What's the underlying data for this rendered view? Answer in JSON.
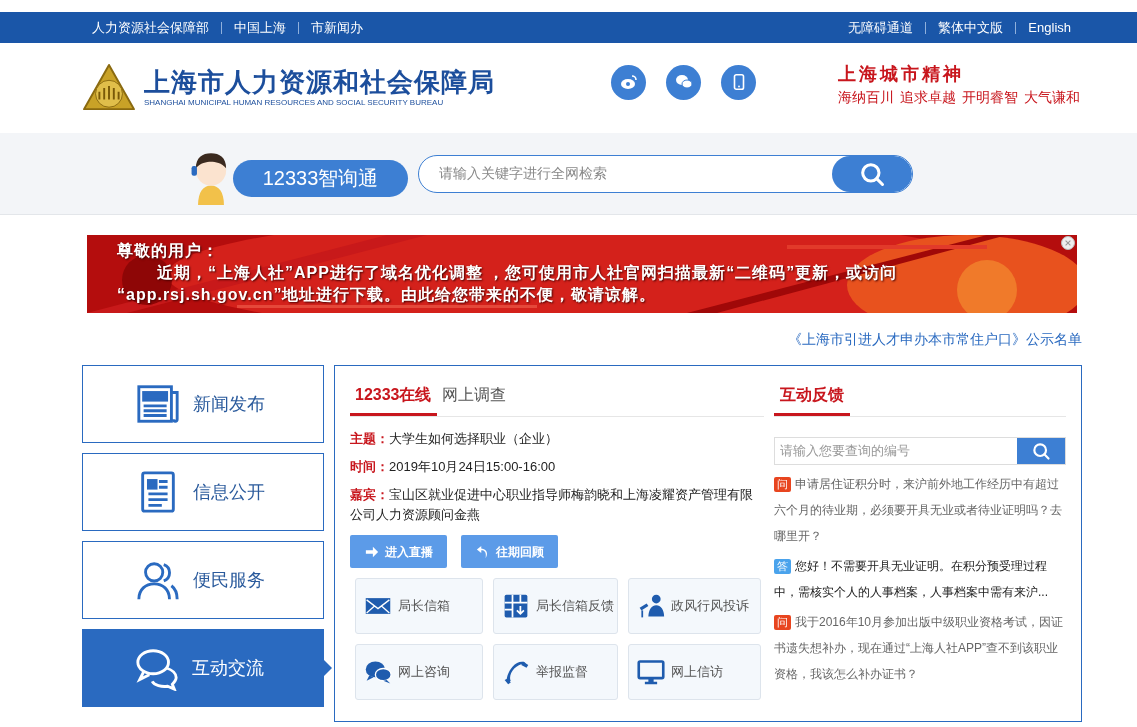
{
  "top_bar": {
    "left_links": [
      "人力资源社会保障部",
      "中国上海",
      "市新闻办"
    ],
    "right_links": [
      "无障碍通道",
      "繁体中文版",
      "English"
    ]
  },
  "header": {
    "title": "上海市人力资源和社会保障局",
    "subtitle": "SHANGHAI MUNICIPAL HUMAN RESOURCES AND SOCIAL SECURITY BUREAU",
    "spirit_title": "上海城市精神",
    "spirit_slogans": [
      "海纳百川",
      "追求卓越",
      "开明睿智",
      "大气谦和"
    ]
  },
  "search_band": {
    "assistant_label": "12333智询通",
    "search": {
      "placeholder": "请输入关键字进行全网检索"
    }
  },
  "banner": {
    "greeting": "尊敬的用户：",
    "lines": [
      "近期，“上海人社”APP进行了域名优化调整 ，您可使用市人社官网扫描最新“二维码”更新，或访问",
      "“app.rsj.sh.gov.cn”地址进行下载。由此给您带来的不便，敬请谅解。"
    ]
  },
  "ticker": "《上海市引进人才申办本市常住户口》公示名单",
  "sidebar": {
    "items": [
      {
        "label": "新闻发布",
        "selected": false
      },
      {
        "label": "信息公开",
        "selected": false
      },
      {
        "label": "便民服务",
        "selected": false
      },
      {
        "label": "互动交流",
        "selected": true
      }
    ]
  },
  "online": {
    "tabs": [
      {
        "label": "12333在线",
        "selected": true
      },
      {
        "label": "网上调查",
        "selected": false
      }
    ],
    "fields": [
      {
        "label": "主题：",
        "value": "大学生如何选择职业（企业）"
      },
      {
        "label": "时间：",
        "value": "2019年10月24日15:00-16:00"
      },
      {
        "label": "嘉宾：",
        "value": "宝山区就业促进中心职业指导师梅韵晓和上海凌耀资产管理有限公司人力资源顾问金燕"
      }
    ],
    "buttons": [
      "进入直播",
      "往期回顾"
    ],
    "services": [
      "局长信箱",
      "局长信箱反馈",
      "政风行风投诉",
      "网上咨询",
      "举报监督",
      "网上信访"
    ]
  },
  "feedback": {
    "title": "互动反馈",
    "search": {
      "placeholder": "请输入您要查询的编号"
    },
    "items": [
      {
        "kind": "question",
        "badge": "问",
        "text": "申请居住证积分时，来沪前外地工作经历中有超过六个月的待业期，必须要开具无业或者待业证明吗？去哪里开？"
      },
      {
        "kind": "answer",
        "badge": "答",
        "text": "您好！不需要开具无业证明。在积分预受理过程中，需核实个人的人事档案，人事档案中需有来沪..."
      },
      {
        "kind": "question",
        "badge": "问",
        "text": "我于2016年10月参加出版中级职业资格考试，因证书遗失想补办，现在通过“上海人社APP”查不到该职业资格，我该怎么补办证书？"
      }
    ]
  }
}
